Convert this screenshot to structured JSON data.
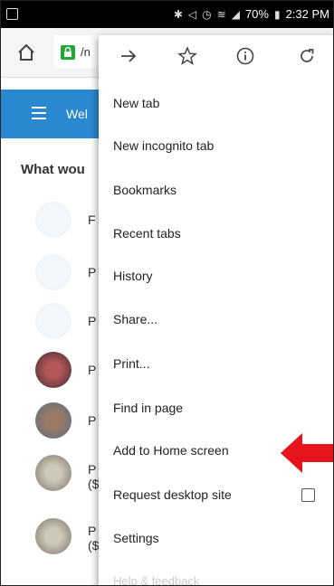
{
  "status_bar": {
    "battery": "70%",
    "time": "2:32 PM"
  },
  "address_bar": {
    "url_partial": "/n"
  },
  "page": {
    "header_text": "Wel",
    "question": "What wou",
    "rows": [
      {
        "letter": "F"
      },
      {
        "letter": "P"
      },
      {
        "letter": "P"
      },
      {
        "letter": "P"
      },
      {
        "letter": "P"
      },
      {
        "letter": "P",
        "sub": "($"
      },
      {
        "letter": "P",
        "sub": "($"
      }
    ]
  },
  "menu": {
    "toolbar_icons": [
      "forward-icon",
      "star-icon",
      "info-icon",
      "refresh-icon"
    ],
    "items": [
      {
        "label": "New tab"
      },
      {
        "label": "New incognito tab"
      },
      {
        "label": "Bookmarks"
      },
      {
        "label": "Recent tabs"
      },
      {
        "label": "History"
      },
      {
        "label": "Share..."
      },
      {
        "label": "Print..."
      },
      {
        "label": "Find in page"
      },
      {
        "label": "Add to Home screen"
      },
      {
        "label": "Request desktop site",
        "checkbox": false
      },
      {
        "label": "Settings"
      }
    ],
    "faded_text": "Help & feedback"
  },
  "colors": {
    "page_header": "#2a88d0",
    "lock": "#1ea834",
    "arrow": "#e8141c"
  }
}
